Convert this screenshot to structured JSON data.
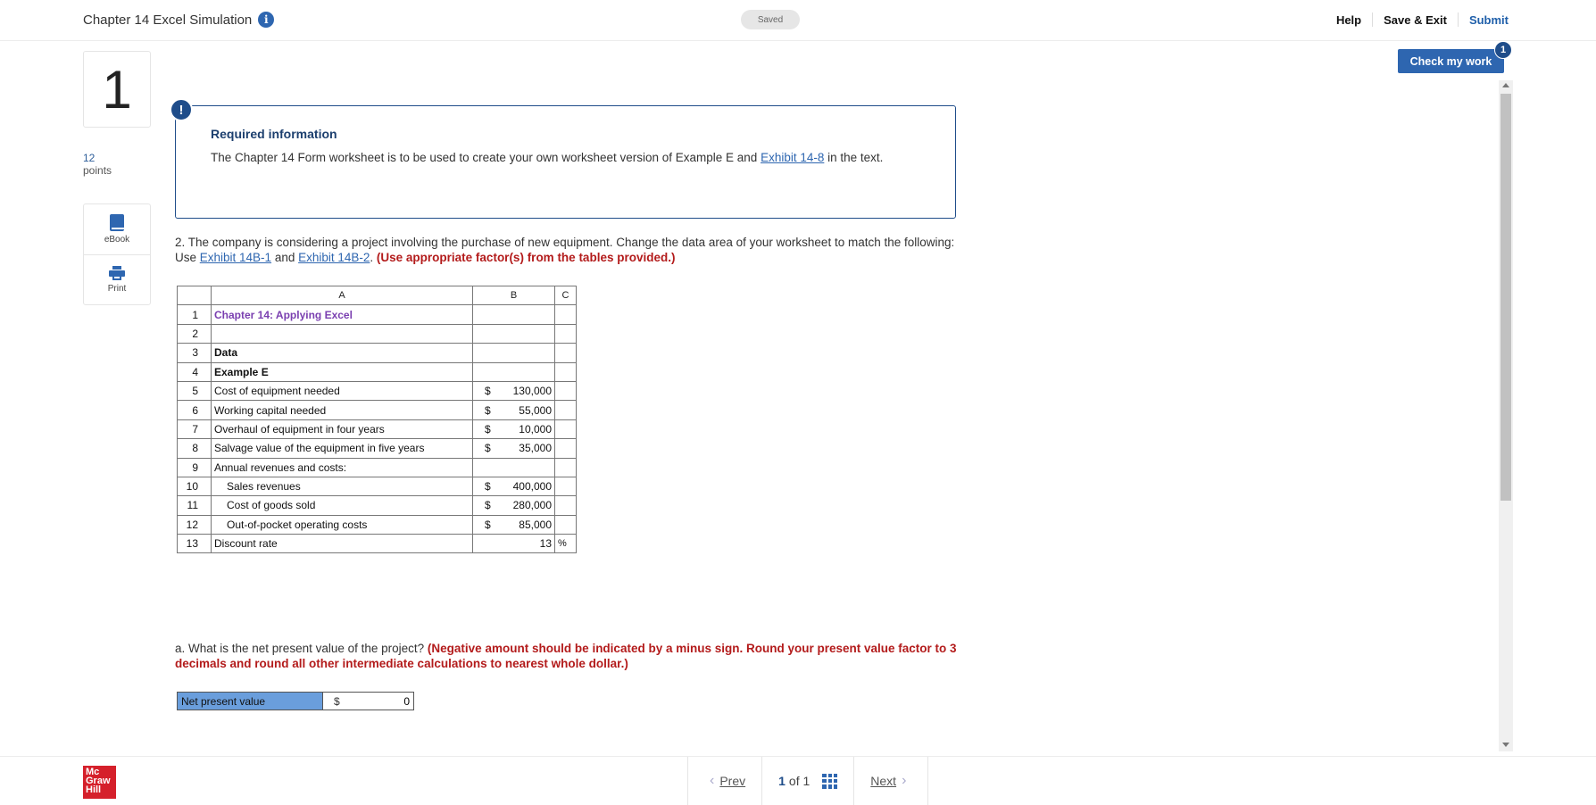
{
  "header": {
    "title": "Chapter 14 Excel Simulation",
    "info_icon": "i",
    "saved": "Saved",
    "help": "Help",
    "save_exit": "Save & Exit",
    "submit": "Submit"
  },
  "question": {
    "number": "1",
    "points_value": "12",
    "points_label": "points"
  },
  "tools": {
    "ebook": "eBook",
    "print": "Print"
  },
  "required_info": {
    "badge": "!",
    "title": "Required information",
    "text_before": "The Chapter 14 Form worksheet is to be used to create your own worksheet version of Example E and ",
    "link": "Exhibit 14-8",
    "text_after": " in the text."
  },
  "prompt": {
    "text_before": "2. The company is considering a project involving the purchase of new equipment. Change the data area of your worksheet to match the following: Use ",
    "link1": "Exhibit 14B-1",
    "and": " and ",
    "link2": "Exhibit 14B-2",
    "period": ". ",
    "instruction": "(Use appropriate factor(s) from the tables provided.)"
  },
  "sheet": {
    "col_a": "A",
    "col_b": "B",
    "col_c": "C",
    "rows": [
      {
        "n": "1",
        "a": "Chapter 14: Applying Excel",
        "cur": "",
        "val": "",
        "c": ""
      },
      {
        "n": "2",
        "a": "",
        "cur": "",
        "val": "",
        "c": ""
      },
      {
        "n": "3",
        "a": "Data",
        "cur": "",
        "val": "",
        "c": ""
      },
      {
        "n": "4",
        "a": "Example E",
        "cur": "",
        "val": "",
        "c": ""
      },
      {
        "n": "5",
        "a": "Cost of equipment needed",
        "cur": "$",
        "val": "130,000",
        "c": ""
      },
      {
        "n": "6",
        "a": "Working capital needed",
        "cur": "$",
        "val": "55,000",
        "c": ""
      },
      {
        "n": "7",
        "a": "Overhaul of equipment in four years",
        "cur": "$",
        "val": "10,000",
        "c": ""
      },
      {
        "n": "8",
        "a": "Salvage value of the equipment in five years",
        "cur": "$",
        "val": "35,000",
        "c": ""
      },
      {
        "n": "9",
        "a": "Annual revenues and costs:",
        "cur": "",
        "val": "",
        "c": ""
      },
      {
        "n": "10",
        "a": "Sales revenues",
        "cur": "$",
        "val": "400,000",
        "c": ""
      },
      {
        "n": "11",
        "a": "Cost of goods sold",
        "cur": "$",
        "val": "280,000",
        "c": ""
      },
      {
        "n": "12",
        "a": "Out-of-pocket operating costs",
        "cur": "$",
        "val": "85,000",
        "c": ""
      },
      {
        "n": "13",
        "a": "Discount rate",
        "cur": "",
        "val": "13",
        "c": "%"
      }
    ]
  },
  "part_a": {
    "text": "a. What is the net present value of the project? ",
    "instruction": "(Negative amount should be indicated by a minus sign. Round your present value factor to 3 decimals and round all other intermediate calculations to nearest whole dollar.)",
    "label": "Net present value",
    "currency": "$",
    "value": "0"
  },
  "check": {
    "label": "Check my work",
    "badge": "1"
  },
  "footer": {
    "logo_line1": "Mc",
    "logo_line2": "Graw",
    "logo_line3": "Hill",
    "prev": "Prev",
    "page_current": "1",
    "page_of": "of 1",
    "next": "Next"
  },
  "colors": {
    "brand_blue": "#2e66b0",
    "dark_blue": "#1f4d8a",
    "alert_red": "#b31b1b",
    "logo_red": "#d5202b",
    "answer_label_blue": "#6a9edc"
  }
}
